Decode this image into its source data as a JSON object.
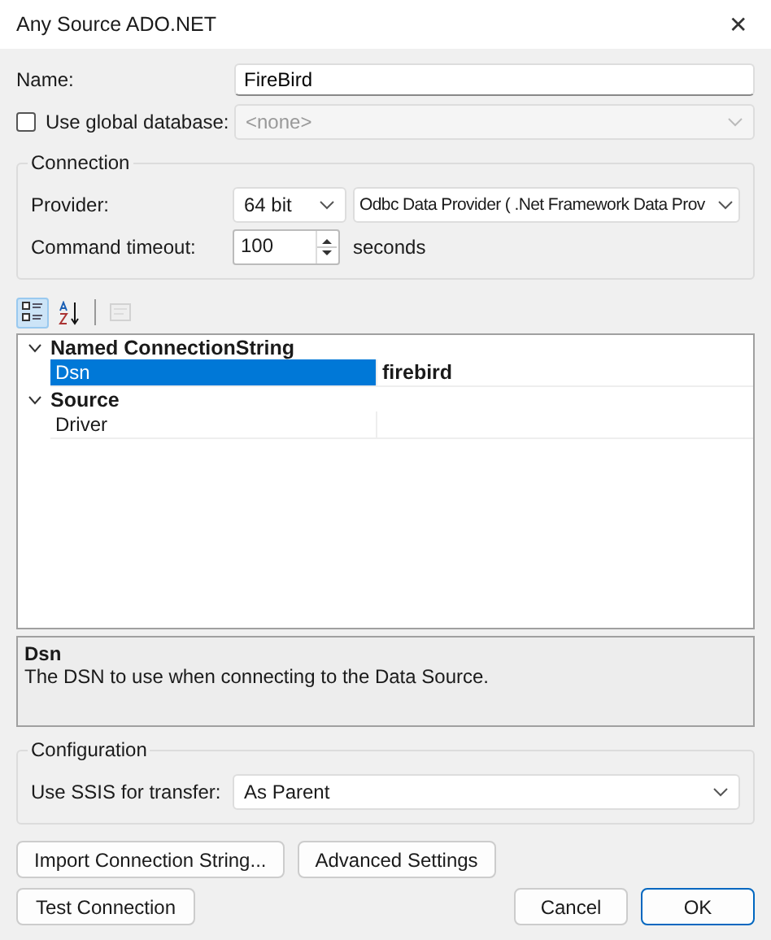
{
  "window": {
    "title": "Any Source ADO.NET",
    "close": "✕"
  },
  "name": {
    "label": "Name:",
    "value": "FireBird"
  },
  "global_database": {
    "label": "Use global database:",
    "checked": false,
    "value": "<none>",
    "disabled": true
  },
  "connection": {
    "title": "Connection",
    "provider_label": "Provider:",
    "bitness": "64 bit",
    "provider": "Odbc Data Provider ( .Net Framework Data Prov",
    "timeout_label": "Command timeout:",
    "timeout": "100",
    "timeout_unit": "seconds"
  },
  "toolbar": [
    {
      "kind": "categorized",
      "selected": true,
      "disabled": false
    },
    {
      "kind": "alphabetical",
      "selected": false,
      "disabled": false
    },
    {
      "kind": "pages",
      "selected": false,
      "disabled": true
    }
  ],
  "property_grid": [
    {
      "category": "Named ConnectionString",
      "expanded": true,
      "children": [
        {
          "name": "Dsn",
          "value": "firebird",
          "selected": true
        }
      ]
    },
    {
      "category": "Source",
      "expanded": true,
      "children": [
        {
          "name": "Driver",
          "selected": false
        }
      ]
    }
  ],
  "description": {
    "title": "Dsn",
    "text": "The DSN to use when connecting to the Data Source."
  },
  "configuration": {
    "title": "Configuration",
    "label": "Use SSIS for transfer:",
    "value": "As Parent"
  },
  "buttons": [
    {
      "label": "Import Connection String...",
      "kind": "action",
      "default": false
    },
    {
      "label": "Advanced Settings",
      "kind": "action",
      "default": false
    },
    {
      "label": "Test Connection",
      "kind": "test",
      "default": false
    },
    {
      "label": "Cancel",
      "kind": "dialog",
      "default": false
    },
    {
      "label": "OK",
      "kind": "dialog",
      "default": true
    }
  ]
}
